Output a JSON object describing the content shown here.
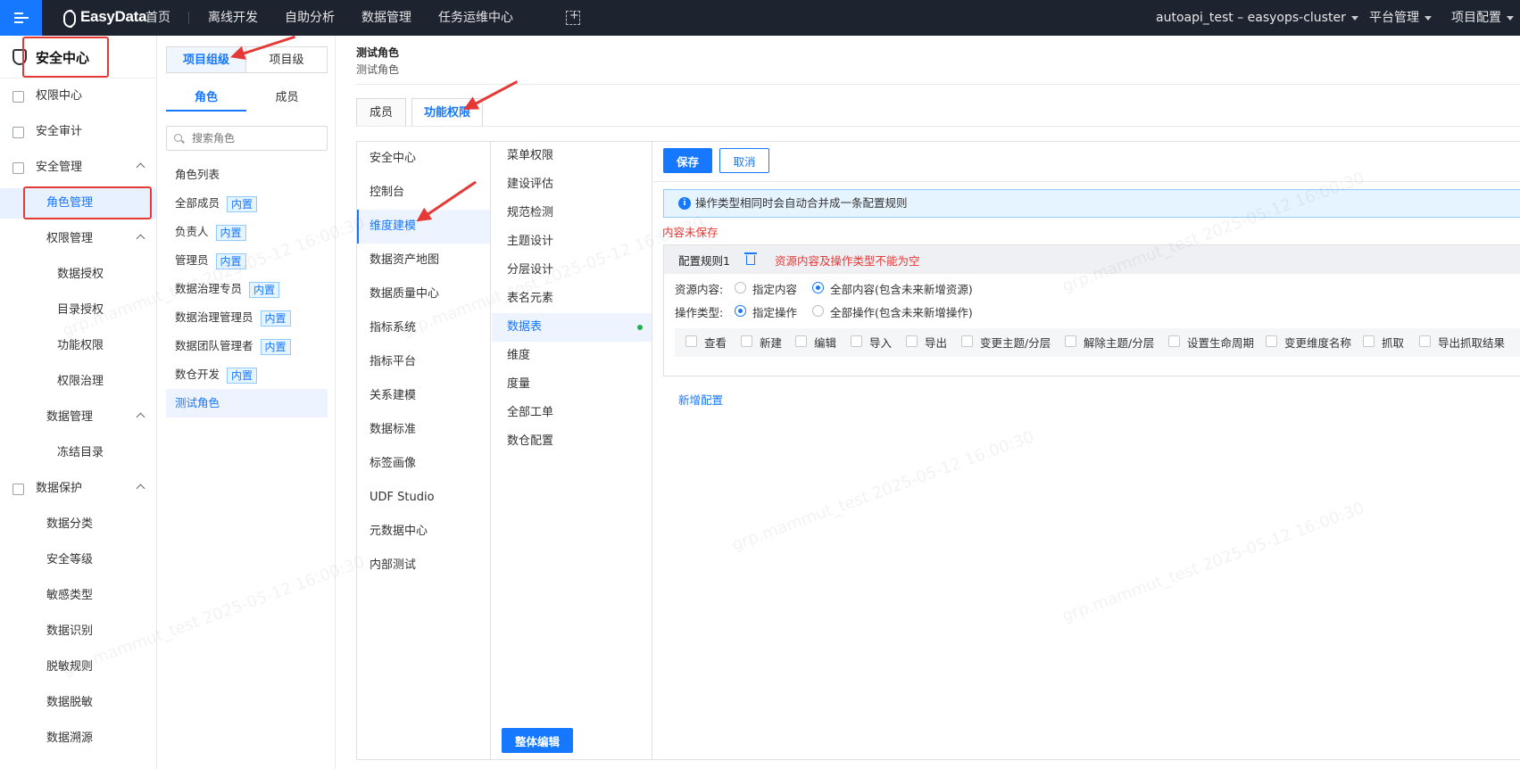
{
  "topbar": {
    "logo": "EasyData",
    "nav": [
      "首页",
      "离线开发",
      "自助分析",
      "数据管理",
      "任务运维中心"
    ],
    "cluster": "autoapi_test – easyops-cluster",
    "platform": "平台管理",
    "project": "项目配置"
  },
  "sidebar": {
    "title": "安全中心",
    "items": [
      "权限中心",
      "安全审计",
      "安全管理",
      "角色管理",
      "权限管理",
      "数据授权",
      "目录授权",
      "功能权限",
      "权限治理",
      "数据管理",
      "冻结目录",
      "数据保护",
      "数据分类",
      "安全等级",
      "敏感类型",
      "数据识别",
      "脱敏规则",
      "数据脱敏",
      "数据溯源"
    ]
  },
  "rolepanel": {
    "level_tabs": [
      "项目组级",
      "项目级"
    ],
    "sub_tabs": [
      "角色",
      "成员"
    ],
    "search_placeholder": "搜索角色",
    "roles": [
      {
        "name": "角色列表",
        "tag": ""
      },
      {
        "name": "全部成员",
        "tag": "内置"
      },
      {
        "name": "负责人",
        "tag": "内置"
      },
      {
        "name": "管理员",
        "tag": "内置"
      },
      {
        "name": "数据治理专员",
        "tag": "内置"
      },
      {
        "name": "数据治理管理员",
        "tag": "内置"
      },
      {
        "name": "数据团队管理者",
        "tag": "内置"
      },
      {
        "name": "数仓开发",
        "tag": "内置"
      },
      {
        "name": "测试角色",
        "tag": ""
      }
    ]
  },
  "main": {
    "role_title": "测试角色",
    "role_subtitle": "测试角色",
    "tabs": [
      "成员",
      "功能权限"
    ],
    "modules": [
      "安全中心",
      "控制台",
      "维度建模",
      "数据资产地图",
      "数据质量中心",
      "指标系统",
      "指标平台",
      "关系建模",
      "数据标准",
      "标签画像",
      "UDF Studio",
      "元数据中心",
      "内部测试"
    ],
    "submodules": [
      "菜单权限",
      "建设评估",
      "规范检测",
      "主题设计",
      "分层设计",
      "表名元素",
      "数据表",
      "维度",
      "度量",
      "全部工单",
      "数仓配置"
    ],
    "bulk_edit": "整体编辑",
    "save": "保存",
    "cancel": "取消",
    "info": "操作类型相同时会自动合并成一条配置规则",
    "unsaved": "内容未保存",
    "rule_title": "配置规则1",
    "rule_error": "资源内容及操作类型不能为空",
    "resource_label": "资源内容:",
    "resource_options": [
      "指定内容",
      "全部内容(包含未来新增资源)"
    ],
    "op_label": "操作类型:",
    "op_options": [
      "指定操作",
      "全部操作(包含未来新增操作)"
    ],
    "operations": [
      "查看",
      "新建",
      "编辑",
      "导入",
      "导出",
      "变更主题/分层",
      "解除主题/分层",
      "设置生命周期",
      "变更维度名称",
      "抓取",
      "导出抓取结果"
    ],
    "add_config": "新增配置"
  },
  "watermark": "grp.mammut_test 2025-05-12 16:00:30",
  "colors": {
    "accent": "#1677ff",
    "topbar": "#1e2330",
    "annotation": "#e53935"
  }
}
